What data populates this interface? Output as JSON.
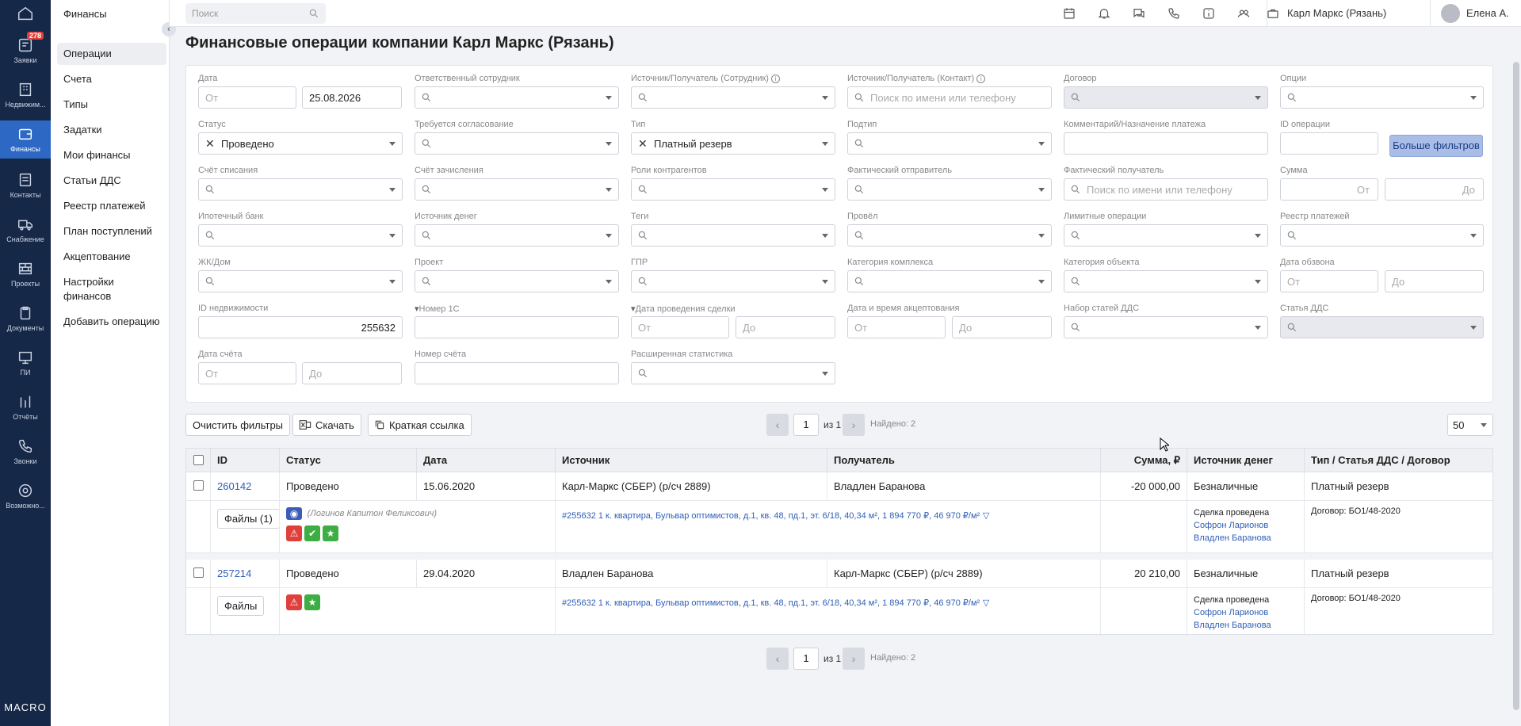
{
  "rail": {
    "items": [
      {
        "label": "Заявки",
        "icon": "requests-icon",
        "badge": "278"
      },
      {
        "label": "Недвижим...",
        "icon": "building-icon"
      },
      {
        "label": "Финансы",
        "icon": "wallet-icon",
        "active": true
      },
      {
        "label": "Контакты",
        "icon": "contacts-icon"
      },
      {
        "label": "Снабжение",
        "icon": "truck-icon"
      },
      {
        "label": "Проекты",
        "icon": "bricks-icon"
      },
      {
        "label": "Документы",
        "icon": "clipboard-icon"
      },
      {
        "label": "ПИ",
        "icon": "presentation-icon"
      },
      {
        "label": "Отчёты",
        "icon": "bars-icon"
      },
      {
        "label": "Звонки",
        "icon": "phone-icon"
      },
      {
        "label": "Возможно...",
        "icon": "gear-icon"
      }
    ],
    "logo": "MACRO"
  },
  "sidebar": {
    "title": "Финансы",
    "items": [
      "Операции",
      "Счета",
      "Типы",
      "Задатки",
      "Мои финансы",
      "Статьи ДДС",
      "Реестр платежей",
      "План поступлений",
      "Акцептование",
      "Настройки финансов",
      "Добавить операцию"
    ]
  },
  "topbar": {
    "search_placeholder": "Поиск",
    "company": "Карл Маркс (Рязань)",
    "user": "Елена А."
  },
  "page_title": "Финансовые операции компании Карл Маркс (Рязань)",
  "filters": {
    "date": {
      "label": "Дата",
      "from": "От",
      "to_value": "25.08.2026"
    },
    "responsible": {
      "label": "Ответственный сотрудник"
    },
    "src_employee": {
      "label": "Источник/Получатель (Сотрудник)"
    },
    "src_contact": {
      "label": "Источник/Получатель (Контакт)",
      "placeholder": "Поиск по имени или телефону"
    },
    "contract": {
      "label": "Договор"
    },
    "options": {
      "label": "Опции"
    },
    "status": {
      "label": "Статус",
      "value": "Проведено"
    },
    "approval": {
      "label": "Требуется согласование"
    },
    "type": {
      "label": "Тип",
      "value": "Платный резерв"
    },
    "subtype": {
      "label": "Подтип"
    },
    "comment": {
      "label": "Комментарий/Назначение платежа"
    },
    "op_id": {
      "label": "ID операции"
    },
    "more_button": "Больше фильтров",
    "debit_account": {
      "label": "Счёт списания"
    },
    "credit_account": {
      "label": "Счёт зачисления"
    },
    "counterparty_roles": {
      "label": "Роли контрагентов"
    },
    "actual_sender": {
      "label": "Фактический отправитель"
    },
    "actual_receiver": {
      "label": "Фактический получатель",
      "placeholder": "Поиск по имени или телефону"
    },
    "amount": {
      "label": "Сумма",
      "from": "От",
      "to": "До"
    },
    "mortgage_bank": {
      "label": "Ипотечный банк"
    },
    "money_source": {
      "label": "Источник денег"
    },
    "tags": {
      "label": "Теги"
    },
    "conducted_by": {
      "label": "Провёл"
    },
    "limit_ops": {
      "label": "Лимитные операции"
    },
    "payments_registry": {
      "label": "Реестр платежей"
    },
    "complex": {
      "label": "ЖК/Дом"
    },
    "project": {
      "label": "Проект"
    },
    "gpr": {
      "label": "ГПР"
    },
    "complex_category": {
      "label": "Категория комплекса"
    },
    "object_category": {
      "label": "Категория объекта"
    },
    "ring_date": {
      "label": "Дата обзвона",
      "from": "От",
      "to": "До"
    },
    "estate_id": {
      "label": "ID недвижимости",
      "value": "255632"
    },
    "number_1c": {
      "label": "Номер 1С"
    },
    "deal_date": {
      "label": "Дата проведения сделки",
      "from": "От",
      "to": "До"
    },
    "accept_datetime": {
      "label": "Дата и время акцептования",
      "from": "От",
      "to": "До"
    },
    "dds_set": {
      "label": "Набор статей ДДС"
    },
    "dds_item": {
      "label": "Статья ДДС"
    },
    "invoice_date": {
      "label": "Дата счёта",
      "from": "От",
      "to": "До"
    },
    "invoice_number": {
      "label": "Номер счёта"
    },
    "ext_stats": {
      "label": "Расширенная статистика"
    }
  },
  "toolbar": {
    "clear": "Очистить фильтры",
    "download": "Скачать",
    "short_link": "Краткая ссылка",
    "page": "1",
    "of": "из 1",
    "found": "Найдено: 2",
    "per_page": "50"
  },
  "table": {
    "headers": [
      "ID",
      "Статус",
      "Дата",
      "Источник",
      "Получатель",
      "Сумма, ₽",
      "Источник денег",
      "Тип / Статья ДДС / Договор"
    ],
    "rows": [
      {
        "id": "260142",
        "status": "Проведено",
        "date": "15.06.2020",
        "source": "Карл-Маркс (СБЕР) (р/сч 2889)",
        "receiver": "Владлен Баранова",
        "amount": "-20 000,00",
        "money_source": "Безналичные",
        "type": "Платный резерв",
        "files": "Файлы (1)",
        "author": "(Логинов Капитон Феликсович)",
        "estate": "#255632 1 к. квартира, Бульвар оптимистов, д.1, кв. 48, пд.1, эт. 6/18, 40,34 м², 1 894 770 ₽, 46 970 ₽/м²",
        "deal_status": "Сделка проведена",
        "person1": "Софрон Ларионов",
        "person2": "Владлен Баранова",
        "contract": "Договор: БО1/48-2020"
      },
      {
        "id": "257214",
        "status": "Проведено",
        "date": "29.04.2020",
        "source": "Владлен Баранова",
        "receiver": "Карл-Маркс (СБЕР) (р/сч 2889)",
        "amount": "20 210,00",
        "money_source": "Безналичные",
        "type": "Платный резерв",
        "files": "Файлы",
        "estate": "#255632 1 к. квартира, Бульвар оптимистов, д.1, кв. 48, пд.1, эт. 6/18, 40,34 м², 1 894 770 ₽, 46 970 ₽/м²",
        "deal_status": "Сделка проведена",
        "person1": "Софрон Ларионов",
        "person2": "Владлен Баранова",
        "contract": "Договор: БО1/48-2020"
      }
    ]
  },
  "colors": {
    "rail": "#162847",
    "accent": "#2d68c4",
    "link": "#2f5fb8",
    "danger": "#e0403c",
    "success": "#3cae43"
  }
}
